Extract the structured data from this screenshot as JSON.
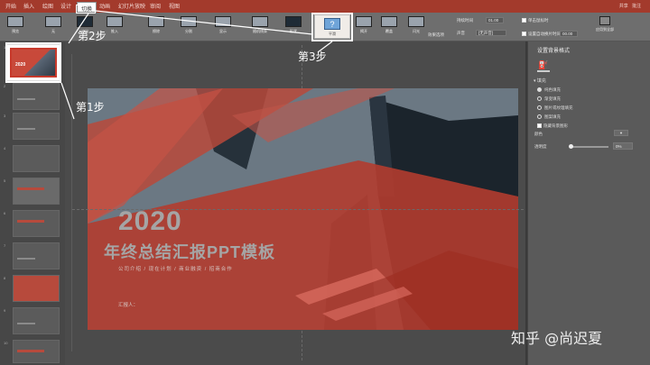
{
  "ribbon_tabs": [
    "开始",
    "插入",
    "绘图",
    "设计",
    "切换",
    "动画",
    "幻灯片放映",
    "审阅",
    "视图"
  ],
  "active_tab": "切换",
  "ribbon_right": [
    "共享",
    "批注"
  ],
  "ribbon": {
    "preview_label": "预览",
    "transitions": [
      "无",
      "淡出",
      "推入",
      "擦除",
      "分割",
      "显示",
      "随机线条",
      "形状",
      "揭开",
      "覆盖",
      "闪光"
    ],
    "morph_label": "平滑",
    "morph_icon": "?",
    "effect_options": "效果选项",
    "duration_label": "持续时间",
    "duration_value": "01.00",
    "sound_label": "声音",
    "sound_value": "[无声音]",
    "on_click_label": "单击鼠标时",
    "after_label": "设置自动换片时间",
    "after_value": "00.00",
    "apply_all": "应用到全部"
  },
  "slides_panel": {
    "numbers": [
      "1",
      "2",
      "3",
      "4",
      "5",
      "6",
      "7",
      "8",
      "9",
      "10"
    ],
    "first_thumb_text": "2020"
  },
  "slide": {
    "year": "2020",
    "title": "年终总结汇报PPT模板",
    "subtitle": "公司介绍 / 现在计划 / 商业融资 / 招商合作",
    "reporter": "汇报人："
  },
  "format_pane": {
    "title": "设置背景格式",
    "section": "填充",
    "options": [
      "纯色填充",
      "渐变填充",
      "图片或纹理填充",
      "图案填充",
      "隐藏背景图形"
    ],
    "color_label": "颜色",
    "transparency_label": "透明度",
    "transparency_value": "0%",
    "transparency": 0
  },
  "annotations": {
    "step1": "第1步",
    "step2": "第2步",
    "step3": "第3步"
  },
  "watermark": "知乎 @尚迟夏",
  "colors": {
    "accent": "#c8392b",
    "ribbon": "#a33a2c"
  }
}
